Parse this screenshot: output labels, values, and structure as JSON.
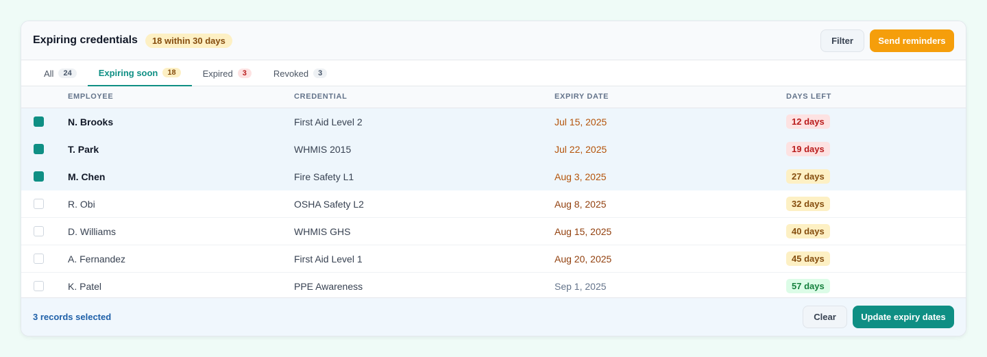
{
  "header": {
    "title": "Expiring credentials",
    "summary_badge": "18 within 30 days",
    "filter_label": "Filter",
    "send_label": "Send reminders"
  },
  "tabs": [
    {
      "label": "All",
      "count": "24"
    },
    {
      "label": "Expiring soon",
      "count": "18"
    },
    {
      "label": "Expired",
      "count": "3"
    },
    {
      "label": "Revoked",
      "count": "3"
    }
  ],
  "table": {
    "columns": [
      "EMPLOYEE",
      "CREDENTIAL",
      "EXPIRY DATE",
      "DAYS LEFT"
    ],
    "rows": [
      {
        "employee": "N. Brooks",
        "credential": "First Aid Level 2",
        "expiry": "Jul 15, 2025",
        "days_left": "12 days",
        "checked": true
      },
      {
        "employee": "T. Park",
        "credential": "WHMIS 2015",
        "expiry": "Jul 22, 2025",
        "days_left": "19 days",
        "checked": true
      },
      {
        "employee": "M. Chen",
        "credential": "Fire Safety L1",
        "expiry": "Aug 3, 2025",
        "days_left": "27 days",
        "checked": true
      },
      {
        "employee": "R. Obi",
        "credential": "OSHA Safety L2",
        "expiry": "Aug 8, 2025",
        "days_left": "32 days",
        "checked": false
      },
      {
        "employee": "D. Williams",
        "credential": "WHMIS GHS",
        "expiry": "Aug 15, 2025",
        "days_left": "40 days",
        "checked": false
      },
      {
        "employee": "A. Fernandez",
        "credential": "First Aid Level 1",
        "expiry": "Aug 20, 2025",
        "days_left": "45 days",
        "checked": false
      },
      {
        "employee": "K. Patel",
        "credential": "PPE Awareness",
        "expiry": "Sep 1, 2025",
        "days_left": "57 days",
        "checked": false
      }
    ]
  },
  "footer": {
    "selected_text": "3 records selected",
    "clear_label": "Clear",
    "update_label": "Update expiry dates"
  },
  "colors": {
    "accent": "#0f8f84",
    "warning": "#f59e0b",
    "danger": "#b91c1c",
    "success": "#15803d"
  }
}
